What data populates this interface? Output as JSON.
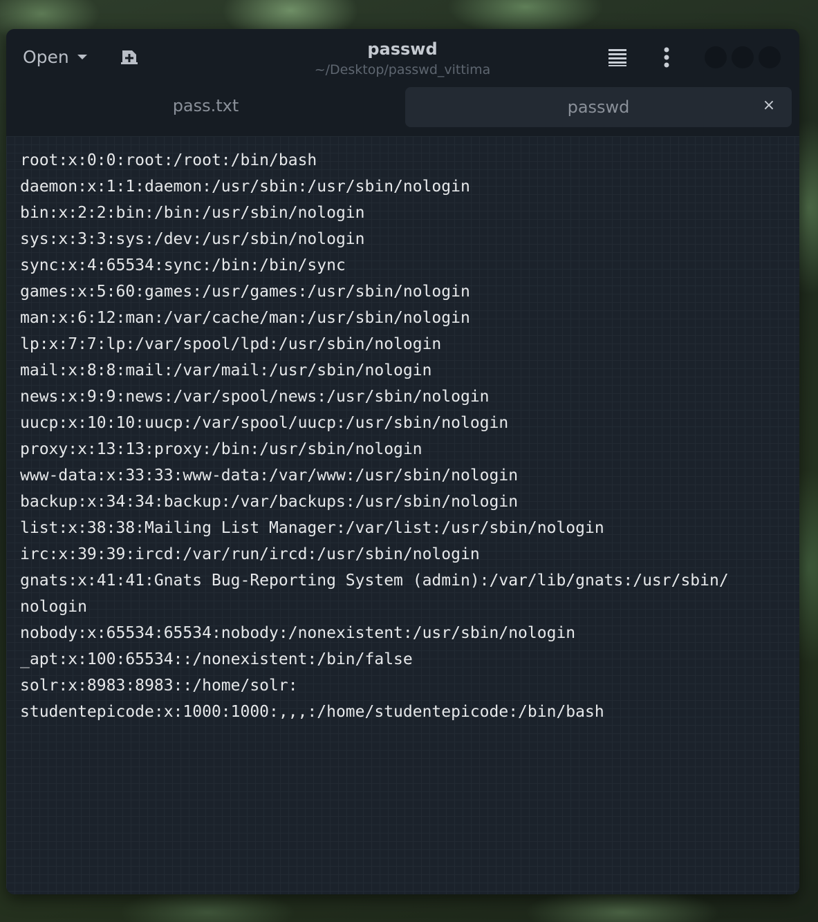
{
  "header": {
    "open_label": "Open",
    "title": "passwd",
    "subtitle": "~/Desktop/passwd_vittima"
  },
  "tabs": [
    {
      "label": "pass.txt",
      "active": false
    },
    {
      "label": "passwd",
      "active": true,
      "close_symbol": "×"
    }
  ],
  "icons": {
    "open": "chevron-down-icon",
    "new_document": "new-document-icon",
    "menu": "hamburger-menu-icon",
    "more": "kebab-menu-icon"
  },
  "colors": {
    "window_bg": "#1b222b",
    "header_bg": "#161c23",
    "active_tab_bg": "#232a33",
    "text": "#e6e8ea"
  },
  "editor": {
    "lines": [
      "root:x:0:0:root:/root:/bin/bash",
      "daemon:x:1:1:daemon:/usr/sbin:/usr/sbin/nologin",
      "bin:x:2:2:bin:/bin:/usr/sbin/nologin",
      "sys:x:3:3:sys:/dev:/usr/sbin/nologin",
      "sync:x:4:65534:sync:/bin:/bin/sync",
      "games:x:5:60:games:/usr/games:/usr/sbin/nologin",
      "man:x:6:12:man:/var/cache/man:/usr/sbin/nologin",
      "lp:x:7:7:lp:/var/spool/lpd:/usr/sbin/nologin",
      "mail:x:8:8:mail:/var/mail:/usr/sbin/nologin",
      "news:x:9:9:news:/var/spool/news:/usr/sbin/nologin",
      "uucp:x:10:10:uucp:/var/spool/uucp:/usr/sbin/nologin",
      "proxy:x:13:13:proxy:/bin:/usr/sbin/nologin",
      "www-data:x:33:33:www-data:/var/www:/usr/sbin/nologin",
      "backup:x:34:34:backup:/var/backups:/usr/sbin/nologin",
      "list:x:38:38:Mailing List Manager:/var/list:/usr/sbin/nologin",
      "irc:x:39:39:ircd:/var/run/ircd:/usr/sbin/nologin",
      "gnats:x:41:41:Gnats Bug-Reporting System (admin):/var/lib/gnats:/usr/sbin/",
      "nologin",
      "nobody:x:65534:65534:nobody:/nonexistent:/usr/sbin/nologin",
      "_apt:x:100:65534::/nonexistent:/bin/false",
      "solr:x:8983:8983::/home/solr:",
      "studentepicode:x:1000:1000:,,,:/home/studentepicode:/bin/bash"
    ]
  }
}
